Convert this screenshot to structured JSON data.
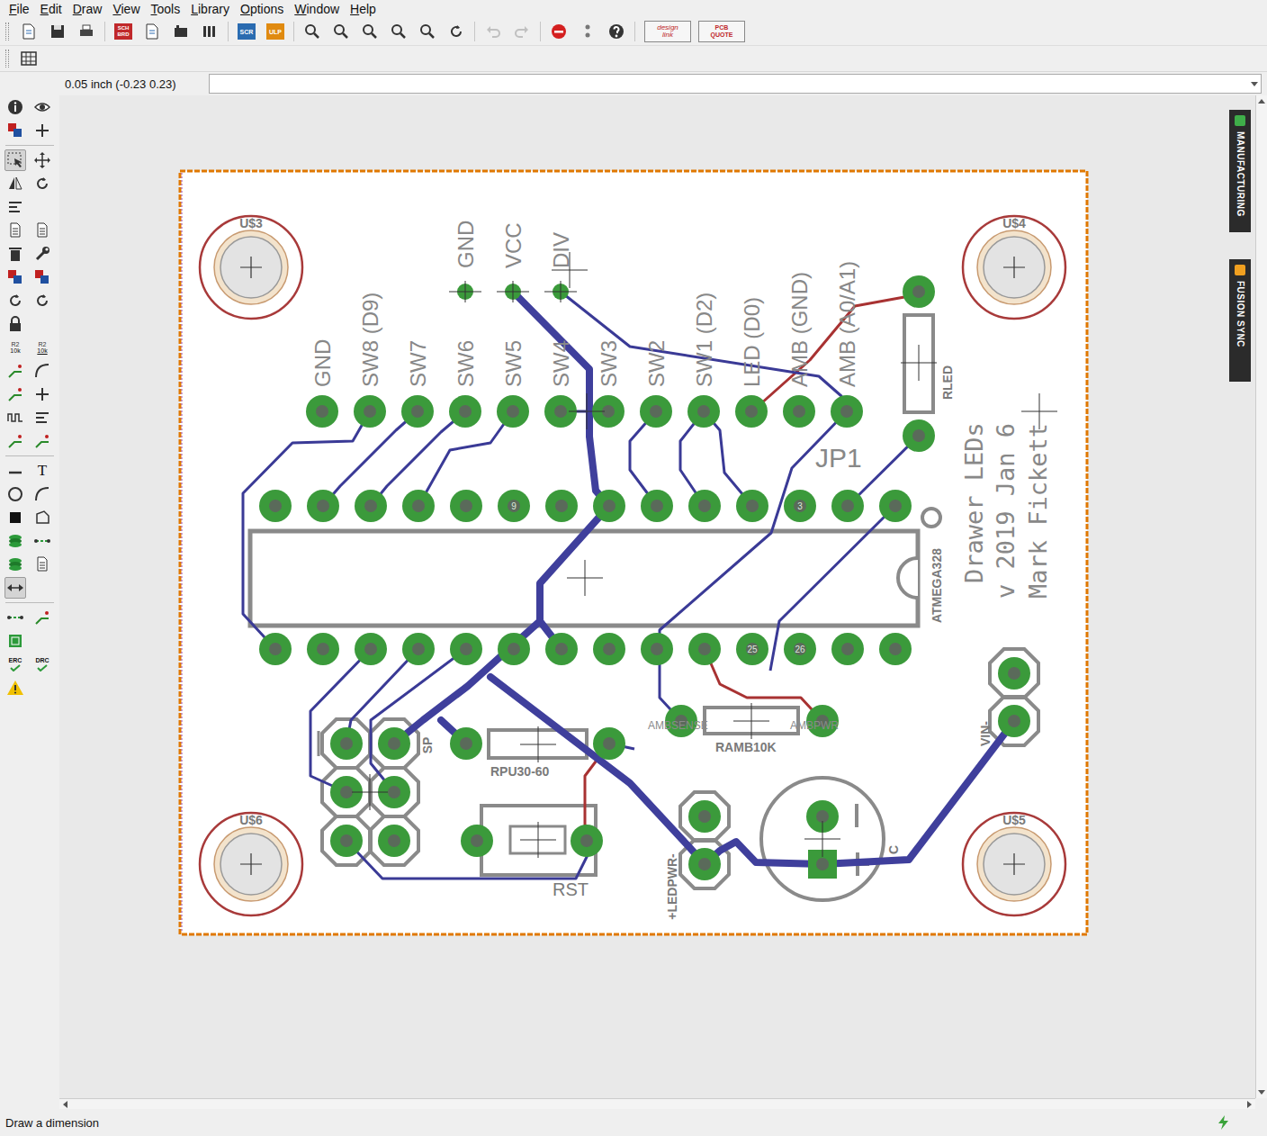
{
  "menu": [
    {
      "label": "File"
    },
    {
      "label": "Edit"
    },
    {
      "label": "Draw"
    },
    {
      "label": "View"
    },
    {
      "label": "Tools"
    },
    {
      "label": "Library"
    },
    {
      "label": "Options"
    },
    {
      "label": "Window"
    },
    {
      "label": "Help"
    }
  ],
  "toolbar": [
    {
      "kind": "open"
    },
    {
      "kind": "save"
    },
    {
      "kind": "print"
    },
    {
      "kind": "separator"
    },
    {
      "kind": "schbrd",
      "lines": [
        "SCH",
        "BRD"
      ]
    },
    {
      "kind": "cam"
    },
    {
      "kind": "factory"
    },
    {
      "kind": "library"
    },
    {
      "kind": "separator"
    },
    {
      "kind": "scr",
      "lines": [
        "SCR"
      ]
    },
    {
      "kind": "ulp",
      "lines": [
        "ULP"
      ]
    },
    {
      "kind": "separator"
    },
    {
      "kind": "zoomfit"
    },
    {
      "kind": "zoomin"
    },
    {
      "kind": "zoomout"
    },
    {
      "kind": "zoomsel"
    },
    {
      "kind": "zoomarea"
    },
    {
      "kind": "redraw"
    },
    {
      "kind": "separator"
    },
    {
      "kind": "undo",
      "disabled": true
    },
    {
      "kind": "redo",
      "disabled": true
    },
    {
      "kind": "separator"
    },
    {
      "kind": "stop"
    },
    {
      "kind": "pause"
    },
    {
      "kind": "help"
    },
    {
      "kind": "separator"
    },
    {
      "kind": "designlink",
      "lines": [
        "design",
        "link"
      ]
    },
    {
      "kind": "pcbquote",
      "lines": [
        "PCB",
        "QUOTE"
      ]
    }
  ],
  "coordinates": "0.05 inch (-0.23 0.23)",
  "command": {
    "value": ""
  },
  "left_toolbar": [
    [
      {
        "kind": "info",
        "selected": false
      },
      {
        "kind": "eye",
        "selected": false
      }
    ],
    [
      {
        "kind": "layers",
        "selected": false
      },
      {
        "kind": "mark",
        "selected": false
      }
    ],
    [
      {
        "kind": "separator",
        "selected": false
      }
    ],
    [
      {
        "kind": "select",
        "selected": true
      },
      {
        "kind": "move",
        "selected": false
      }
    ],
    [
      {
        "kind": "mirror",
        "selected": false
      },
      {
        "kind": "rotate",
        "selected": false
      }
    ],
    [
      {
        "kind": "align",
        "selected": false
      }
    ],
    [
      {
        "kind": "copy",
        "selected": false
      },
      {
        "kind": "paste",
        "selected": false
      }
    ],
    [
      {
        "kind": "delete",
        "selected": false
      },
      {
        "kind": "wrench",
        "selected": false
      }
    ],
    [
      {
        "kind": "add",
        "selected": false
      },
      {
        "kind": "replace",
        "selected": false
      }
    ],
    [
      {
        "kind": "change",
        "selected": false
      },
      {
        "kind": "swap",
        "selected": false
      }
    ],
    [
      {
        "kind": "lock",
        "selected": false
      }
    ],
    [
      {
        "kind": "name",
        "selected": false,
        "lines": [
          "R2",
          "10k"
        ]
      },
      {
        "kind": "value",
        "selected": false,
        "lines": [
          "R2",
          "10k"
        ]
      }
    ],
    [
      {
        "kind": "split",
        "selected": false
      },
      {
        "kind": "miter",
        "selected": false
      }
    ],
    [
      {
        "kind": "bend",
        "selected": false
      },
      {
        "kind": "plus",
        "selected": false
      }
    ],
    [
      {
        "kind": "meander",
        "selected": false
      },
      {
        "kind": "lines",
        "selected": false
      }
    ],
    [
      {
        "kind": "route",
        "selected": false
      },
      {
        "kind": "ripup",
        "selected": false
      }
    ],
    [
      {
        "kind": "separator",
        "selected": false
      }
    ],
    [
      {
        "kind": "wire",
        "selected": false
      },
      {
        "kind": "text",
        "selected": false,
        "lines": [
          "T"
        ]
      }
    ],
    [
      {
        "kind": "circle",
        "selected": false
      },
      {
        "kind": "arc",
        "selected": false
      }
    ],
    [
      {
        "kind": "rect",
        "selected": false
      },
      {
        "kind": "polygon",
        "selected": false
      }
    ],
    [
      {
        "kind": "via",
        "selected": false
      },
      {
        "kind": "signal",
        "selected": false
      }
    ],
    [
      {
        "kind": "hole",
        "selected": false
      },
      {
        "kind": "attribute",
        "selected": false
      }
    ],
    [
      {
        "kind": "dimension",
        "selected": true
      }
    ],
    [
      {
        "kind": "separator",
        "selected": false
      }
    ],
    [
      {
        "kind": "ratsnest",
        "selected": false
      },
      {
        "kind": "autorouter",
        "selected": false
      }
    ],
    [
      {
        "kind": "board",
        "selected": false
      }
    ],
    [
      {
        "kind": "erc",
        "selected": false,
        "lines": [
          "ERC"
        ]
      },
      {
        "kind": "drc",
        "selected": false,
        "lines": [
          "DRC"
        ]
      }
    ],
    [
      {
        "kind": "warning",
        "selected": false
      }
    ]
  ],
  "side_tabs": [
    {
      "label": "MANUFACTURING",
      "color": "#3fae49"
    },
    {
      "label": "FUSION SYNC",
      "color": "#f0a020"
    }
  ],
  "board": {
    "mounting_holes": [
      {
        "name": "U$3"
      },
      {
        "name": "U$4"
      },
      {
        "name": "U$6"
      },
      {
        "name": "U$5"
      }
    ],
    "header": {
      "name": "JP1",
      "pins": [
        {
          "label": "GND"
        },
        {
          "label": "SW8 (D9)"
        },
        {
          "label": "SW7"
        },
        {
          "label": "SW6"
        },
        {
          "label": "SW5"
        },
        {
          "label": "SW4"
        },
        {
          "label": "SW3"
        },
        {
          "label": "SW2"
        },
        {
          "label": "SW1 (D2)"
        },
        {
          "label": "LED (D0)"
        },
        {
          "label": "AMB (GND)"
        },
        {
          "label": "AMB (A0/A1)"
        }
      ]
    },
    "power_pads": [
      {
        "label": "GND"
      },
      {
        "label": "VCC"
      },
      {
        "label": "DIV"
      }
    ],
    "chip": {
      "name": "ATMEGA328",
      "top_pin_texts": [
        {
          "index": 5,
          "text": "9"
        },
        {
          "index": 11,
          "text": "3"
        }
      ],
      "bottom_pin_texts": [
        {
          "index": 10,
          "text": "25"
        },
        {
          "index": 11,
          "text": "26"
        }
      ]
    },
    "parts": [
      {
        "name": "RLED"
      },
      {
        "name": "RPU30-60"
      },
      {
        "name": "RAMB10K"
      },
      {
        "name": "RST"
      },
      {
        "name": "SP"
      },
      {
        "name": "+LEDPWR-"
      },
      {
        "name": "VIN-"
      },
      {
        "name": "C"
      }
    ],
    "pad_names": [
      {
        "text": "AMBSENSE"
      },
      {
        "text": "AMBPWR"
      }
    ],
    "silkscreen": [
      "Drawer LEDs",
      "v 2019 Jan 6",
      "Mark Fickett"
    ]
  },
  "status_bar": {
    "message": "Draw a dimension"
  }
}
